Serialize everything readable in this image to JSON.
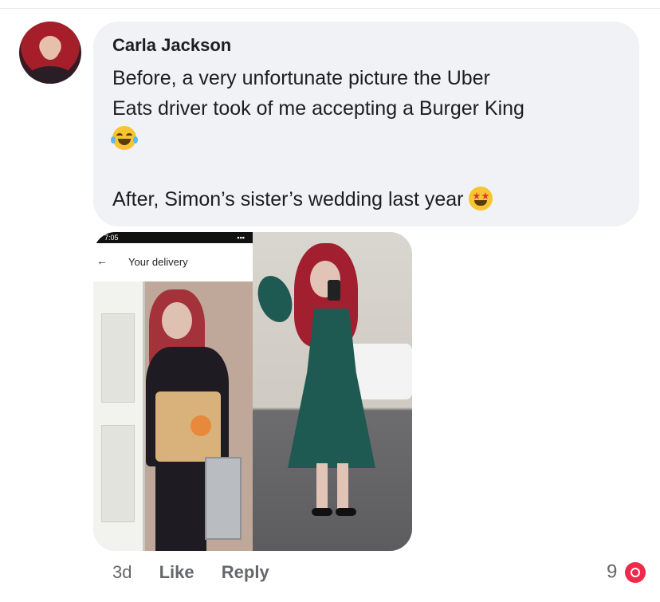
{
  "comment": {
    "author": "Carla Jackson",
    "text_line1": "Before, a very unfortunate picture the Uber",
    "text_line2": "Eats driver took of me accepting a Burger King",
    "text_after": "After, Simon’s sister’s wedding last year",
    "emoji_before": "face-with-tears-of-joy",
    "emoji_after": "star-struck"
  },
  "photo": {
    "screenshot_time": "7:05",
    "app_header_title": "Your delivery"
  },
  "actions": {
    "age": "3d",
    "like_label": "Like",
    "reply_label": "Reply"
  },
  "reactions": {
    "count": "9",
    "type": "love-icon"
  },
  "colors": {
    "bubble_bg": "#f0f2f5",
    "meta_text": "#65676b",
    "love": "#f0284a"
  }
}
